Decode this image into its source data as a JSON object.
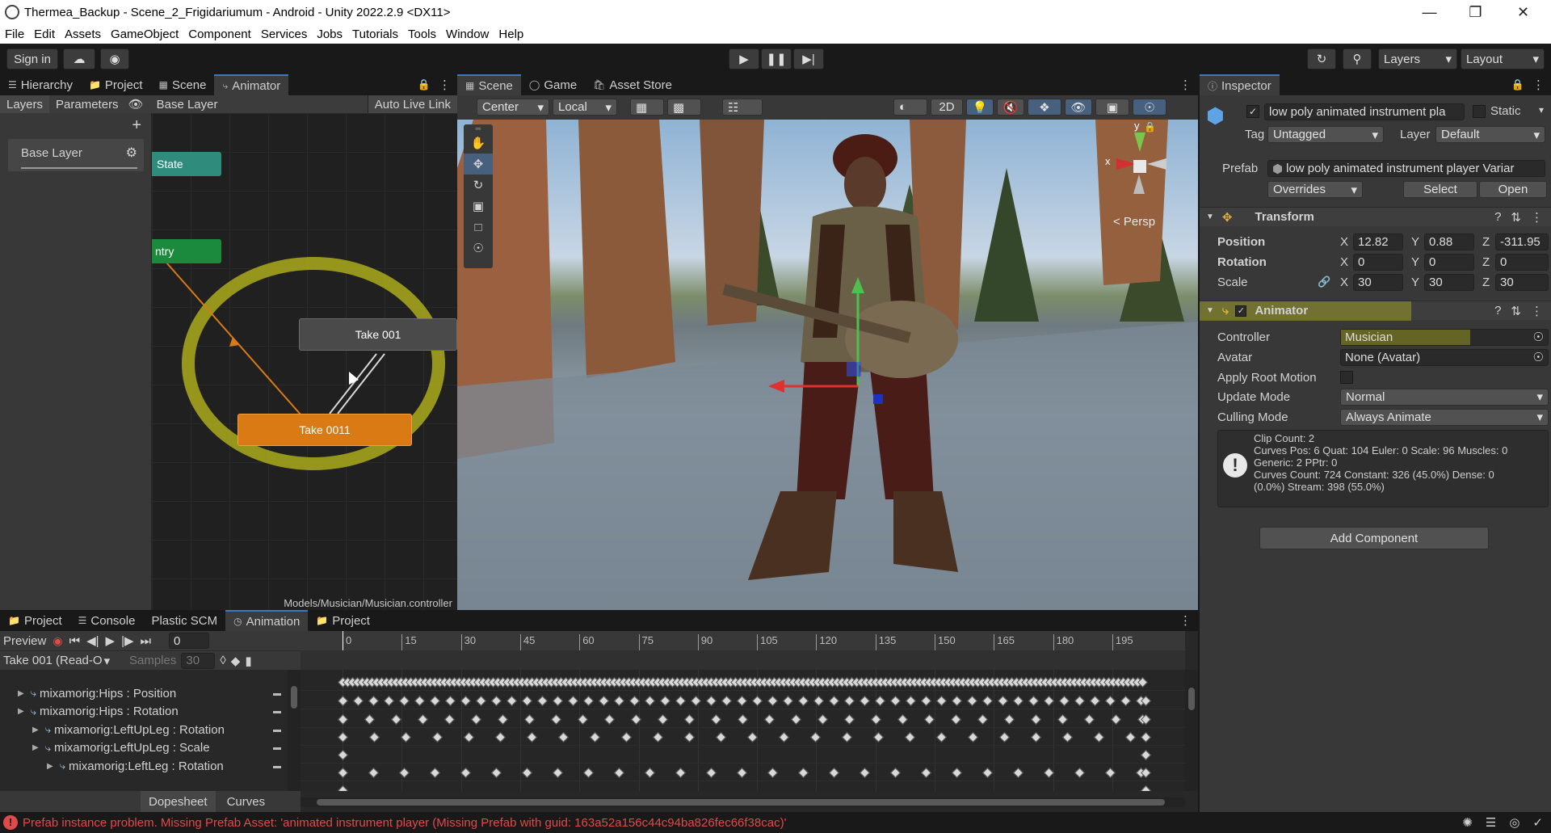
{
  "window": {
    "title": "Thermea_Backup - Scene_2_Frigidariumum - Android - Unity 2022.2.9 <DX11>"
  },
  "menu": [
    "File",
    "Edit",
    "Assets",
    "GameObject",
    "Component",
    "Services",
    "Jobs",
    "Tutorials",
    "Tools",
    "Window",
    "Help"
  ],
  "toolbar": {
    "sign_in": "Sign in",
    "layers": "Layers",
    "layout": "Layout"
  },
  "left_tabs": [
    "Hierarchy",
    "Project",
    "Scene",
    "Animator"
  ],
  "animator": {
    "sub_tabs": [
      "Layers",
      "Parameters"
    ],
    "breadcrumb": "Base Layer",
    "auto_live_link": "Auto Live Link",
    "layer_name": "Base Layer",
    "states": {
      "any_state": "State",
      "entry": "ntry",
      "take001": "Take 001",
      "take0011": "Take 0011"
    },
    "path": "Models/Musician/Musician.controller"
  },
  "scene_tabs": [
    "Scene",
    "Game",
    "Asset Store"
  ],
  "scene_toolbar": {
    "pivot": "Center",
    "space": "Local",
    "mode_2d": "2D",
    "persp": "< Persp",
    "gizmo_x": "x",
    "gizmo_y": "y"
  },
  "inspector": {
    "tab": "Inspector",
    "object_name": "low poly animated instrument pla",
    "static_label": "Static",
    "tag_label": "Tag",
    "tag_value": "Untagged",
    "layer_label": "Layer",
    "layer_value": "Default",
    "prefab_label": "Prefab",
    "prefab_value": "low poly animated instrument player Variar",
    "overrides": "Overrides",
    "select": "Select",
    "open": "Open",
    "transform": {
      "title": "Transform",
      "position_label": "Position",
      "rotation_label": "Rotation",
      "scale_label": "Scale",
      "position": {
        "x": "12.82",
        "y": "0.88",
        "z": "-311.95"
      },
      "rotation": {
        "x": "0",
        "y": "0",
        "z": "0"
      },
      "scale": {
        "x": "30",
        "y": "30",
        "z": "30"
      }
    },
    "animator": {
      "title": "Animator",
      "controller_label": "Controller",
      "controller_value": "Musician",
      "avatar_label": "Avatar",
      "avatar_value": "None (Avatar)",
      "root_motion_label": "Apply Root Motion",
      "update_mode_label": "Update Mode",
      "update_mode_value": "Normal",
      "culling_mode_label": "Culling Mode",
      "culling_mode_value": "Always Animate",
      "info": [
        "Clip Count: 2",
        "Curves Pos: 6 Quat: 104 Euler: 0 Scale: 96 Muscles: 0",
        "Generic: 2 PPtr: 0",
        "Curves Count: 724 Constant: 326 (45.0%) Dense: 0",
        "(0.0%) Stream: 398 (55.0%)"
      ]
    },
    "add_component": "Add Component"
  },
  "bottom_tabs": [
    "Project",
    "Console",
    "Plastic SCM",
    "Animation",
    "Project"
  ],
  "animation": {
    "preview": "Preview",
    "frame": "0",
    "clip": "Take 001 (Read-O",
    "samples_label": "Samples",
    "samples_value": "30",
    "ruler": [
      "0",
      "15",
      "30",
      "45",
      "60",
      "75",
      "90",
      "105",
      "120",
      "135",
      "150",
      "165",
      "180",
      "195"
    ],
    "properties": [
      {
        "name": "mixamorig:Hips : Position",
        "indent": 0
      },
      {
        "name": "mixamorig:Hips : Rotation",
        "indent": 0
      },
      {
        "name": "mixamorig:LeftUpLeg : Rotation",
        "indent": 1
      },
      {
        "name": "mixamorig:LeftUpLeg : Scale",
        "indent": 1
      },
      {
        "name": "mixamorig:LeftLeg : Rotation",
        "indent": 2
      }
    ],
    "view_tabs": [
      "Dopesheet",
      "Curves"
    ]
  },
  "status": {
    "message": "Prefab instance problem. Missing Prefab Asset: 'animated instrument player (Missing Prefab with guid: 163a52a156c44c94ba826fec66f38cac)'"
  },
  "colors": {
    "accent": "#3a79bb",
    "entry_state": "#1c8a3c",
    "any_state": "#2f8c7d",
    "default_state": "#d97a14",
    "error": "#e04a4a",
    "highlight": "#d2d21a"
  }
}
